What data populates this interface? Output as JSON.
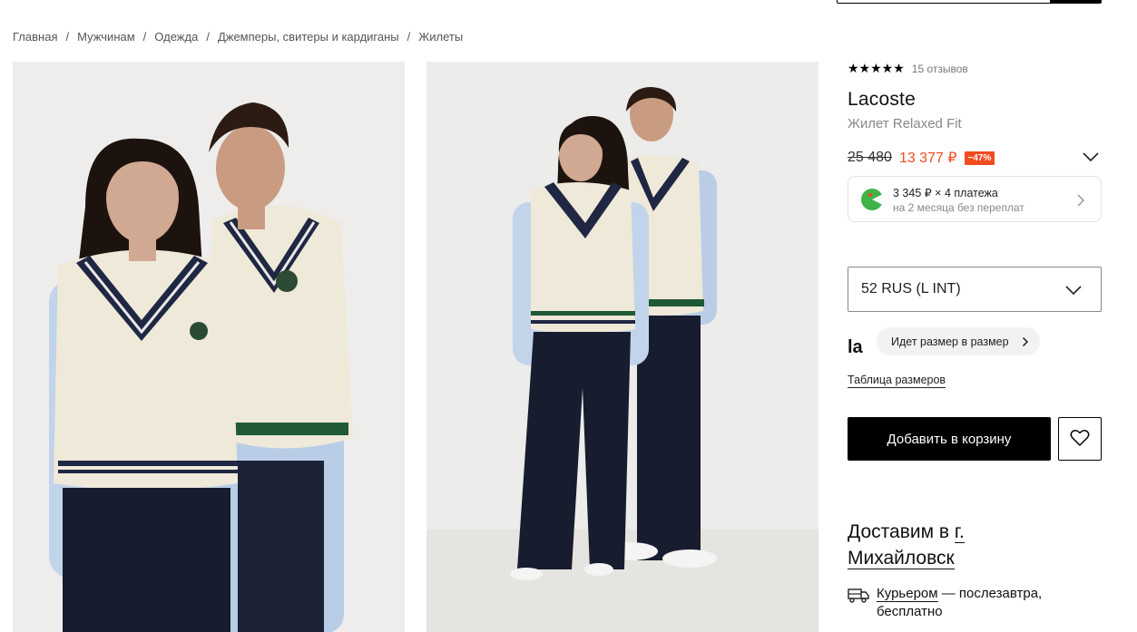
{
  "breadcrumb": [
    "Главная",
    "Мужчинам",
    "Одежда",
    "Джемперы, свитеры и кардиганы",
    "Жилеты"
  ],
  "rating": {
    "stars": "★★★★★",
    "reviews": "15 отзывов",
    "value": 5
  },
  "product": {
    "brand": "Lacoste",
    "name": "Жилет Relaxed Fit"
  },
  "price": {
    "old": "25 480",
    "new": "13 377 ₽",
    "discount": "−47%"
  },
  "installment": {
    "line1": "3 345 ₽ × 4 платежа",
    "line2": "на 2 месяца без переплат"
  },
  "size": {
    "selected": "52 RUS (L INT)"
  },
  "fit": {
    "logo": "la",
    "label": "Идет размер в размер"
  },
  "size_table_link": "Таблица размеров",
  "cart_button": "Добавить в корзину",
  "delivery": {
    "prefix": "Доставим в ",
    "city": "г. Михайловск",
    "courier_link": "Курьером",
    "courier_rest": " — послезавтра, бесплатно"
  },
  "colors": {
    "accent": "#f24b20",
    "primary": "#000000",
    "muted": "#888888"
  },
  "icons": [
    "search-icon",
    "chevron-down-icon",
    "chevron-right-icon",
    "heart-icon",
    "truck-icon",
    "split-logo-icon"
  ]
}
